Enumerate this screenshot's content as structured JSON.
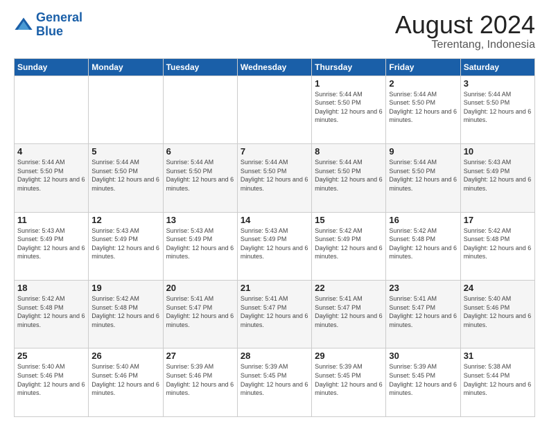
{
  "logo": {
    "line1": "General",
    "line2": "Blue"
  },
  "title": "August 2024",
  "subtitle": "Terentang, Indonesia",
  "days_of_week": [
    "Sunday",
    "Monday",
    "Tuesday",
    "Wednesday",
    "Thursday",
    "Friday",
    "Saturday"
  ],
  "weeks": [
    [
      {
        "day": "",
        "info": ""
      },
      {
        "day": "",
        "info": ""
      },
      {
        "day": "",
        "info": ""
      },
      {
        "day": "",
        "info": ""
      },
      {
        "day": "1",
        "info": "Sunrise: 5:44 AM\nSunset: 5:50 PM\nDaylight: 12 hours and 6 minutes."
      },
      {
        "day": "2",
        "info": "Sunrise: 5:44 AM\nSunset: 5:50 PM\nDaylight: 12 hours and 6 minutes."
      },
      {
        "day": "3",
        "info": "Sunrise: 5:44 AM\nSunset: 5:50 PM\nDaylight: 12 hours and 6 minutes."
      }
    ],
    [
      {
        "day": "4",
        "info": "Sunrise: 5:44 AM\nSunset: 5:50 PM\nDaylight: 12 hours and 6 minutes."
      },
      {
        "day": "5",
        "info": "Sunrise: 5:44 AM\nSunset: 5:50 PM\nDaylight: 12 hours and 6 minutes."
      },
      {
        "day": "6",
        "info": "Sunrise: 5:44 AM\nSunset: 5:50 PM\nDaylight: 12 hours and 6 minutes."
      },
      {
        "day": "7",
        "info": "Sunrise: 5:44 AM\nSunset: 5:50 PM\nDaylight: 12 hours and 6 minutes."
      },
      {
        "day": "8",
        "info": "Sunrise: 5:44 AM\nSunset: 5:50 PM\nDaylight: 12 hours and 6 minutes."
      },
      {
        "day": "9",
        "info": "Sunrise: 5:44 AM\nSunset: 5:50 PM\nDaylight: 12 hours and 6 minutes."
      },
      {
        "day": "10",
        "info": "Sunrise: 5:43 AM\nSunset: 5:49 PM\nDaylight: 12 hours and 6 minutes."
      }
    ],
    [
      {
        "day": "11",
        "info": "Sunrise: 5:43 AM\nSunset: 5:49 PM\nDaylight: 12 hours and 6 minutes."
      },
      {
        "day": "12",
        "info": "Sunrise: 5:43 AM\nSunset: 5:49 PM\nDaylight: 12 hours and 6 minutes."
      },
      {
        "day": "13",
        "info": "Sunrise: 5:43 AM\nSunset: 5:49 PM\nDaylight: 12 hours and 6 minutes."
      },
      {
        "day": "14",
        "info": "Sunrise: 5:43 AM\nSunset: 5:49 PM\nDaylight: 12 hours and 6 minutes."
      },
      {
        "day": "15",
        "info": "Sunrise: 5:42 AM\nSunset: 5:49 PM\nDaylight: 12 hours and 6 minutes."
      },
      {
        "day": "16",
        "info": "Sunrise: 5:42 AM\nSunset: 5:48 PM\nDaylight: 12 hours and 6 minutes."
      },
      {
        "day": "17",
        "info": "Sunrise: 5:42 AM\nSunset: 5:48 PM\nDaylight: 12 hours and 6 minutes."
      }
    ],
    [
      {
        "day": "18",
        "info": "Sunrise: 5:42 AM\nSunset: 5:48 PM\nDaylight: 12 hours and 6 minutes."
      },
      {
        "day": "19",
        "info": "Sunrise: 5:42 AM\nSunset: 5:48 PM\nDaylight: 12 hours and 6 minutes."
      },
      {
        "day": "20",
        "info": "Sunrise: 5:41 AM\nSunset: 5:47 PM\nDaylight: 12 hours and 6 minutes."
      },
      {
        "day": "21",
        "info": "Sunrise: 5:41 AM\nSunset: 5:47 PM\nDaylight: 12 hours and 6 minutes."
      },
      {
        "day": "22",
        "info": "Sunrise: 5:41 AM\nSunset: 5:47 PM\nDaylight: 12 hours and 6 minutes."
      },
      {
        "day": "23",
        "info": "Sunrise: 5:41 AM\nSunset: 5:47 PM\nDaylight: 12 hours and 6 minutes."
      },
      {
        "day": "24",
        "info": "Sunrise: 5:40 AM\nSunset: 5:46 PM\nDaylight: 12 hours and 6 minutes."
      }
    ],
    [
      {
        "day": "25",
        "info": "Sunrise: 5:40 AM\nSunset: 5:46 PM\nDaylight: 12 hours and 6 minutes."
      },
      {
        "day": "26",
        "info": "Sunrise: 5:40 AM\nSunset: 5:46 PM\nDaylight: 12 hours and 6 minutes."
      },
      {
        "day": "27",
        "info": "Sunrise: 5:39 AM\nSunset: 5:46 PM\nDaylight: 12 hours and 6 minutes."
      },
      {
        "day": "28",
        "info": "Sunrise: 5:39 AM\nSunset: 5:45 PM\nDaylight: 12 hours and 6 minutes."
      },
      {
        "day": "29",
        "info": "Sunrise: 5:39 AM\nSunset: 5:45 PM\nDaylight: 12 hours and 6 minutes."
      },
      {
        "day": "30",
        "info": "Sunrise: 5:39 AM\nSunset: 5:45 PM\nDaylight: 12 hours and 6 minutes."
      },
      {
        "day": "31",
        "info": "Sunrise: 5:38 AM\nSunset: 5:44 PM\nDaylight: 12 hours and 6 minutes."
      }
    ]
  ]
}
